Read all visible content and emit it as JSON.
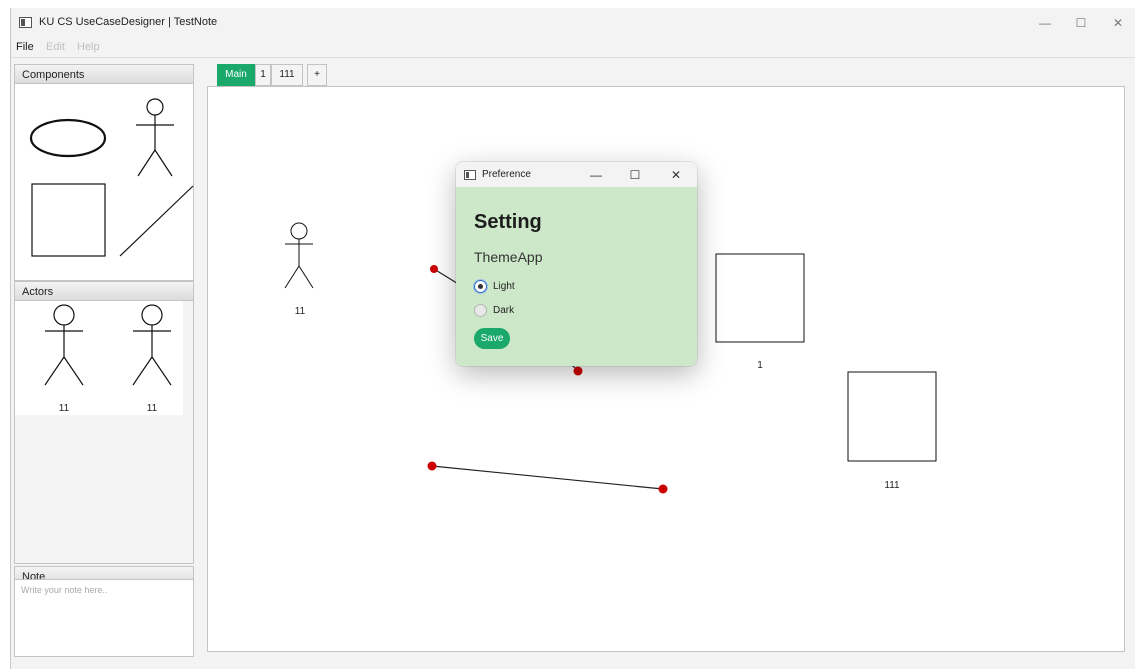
{
  "window": {
    "title": "KU CS UseCaseDesigner | TestNote",
    "minimize": "—",
    "maximize": "☐",
    "close": "✕"
  },
  "menu": {
    "file": "File",
    "edit": "Edit",
    "help": "Help"
  },
  "panels": {
    "components": "Components",
    "actors": "Actors",
    "note": "Note"
  },
  "actors_list": [
    "11",
    "11"
  ],
  "note": {
    "placeholder": "Write your note here.."
  },
  "tabs": [
    "Main",
    "1",
    "111",
    "+"
  ],
  "canvas": {
    "actor_label": "11",
    "box_labels": [
      "1",
      "111"
    ]
  },
  "dialog": {
    "title": "Preference",
    "minimize": "—",
    "maximize": "☐",
    "close": "✕",
    "heading": "Setting",
    "theme_label": "ThemeApp",
    "options": [
      "Light",
      "Dark"
    ],
    "selected": "Light",
    "save": "Save"
  },
  "colors": {
    "accent": "#1aa86b",
    "dialog_bg": "#cce8c8",
    "handle_red": "#cc0000"
  },
  "icons": {
    "app": "window-icon",
    "dialog": "window-icon"
  }
}
